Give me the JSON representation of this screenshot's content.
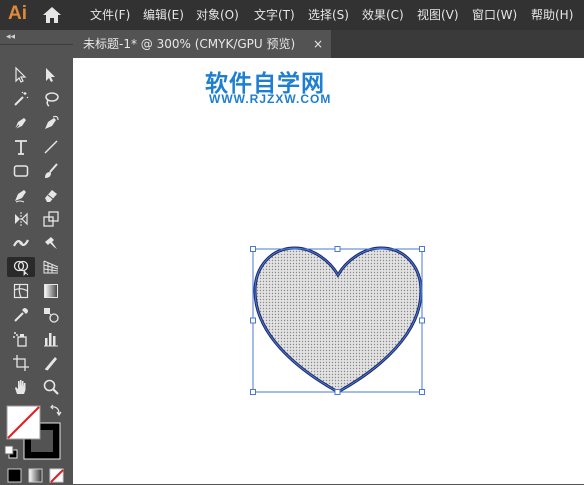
{
  "app": {
    "logo": "Ai"
  },
  "menu": {
    "items": [
      "文件(F)",
      "编辑(E)",
      "对象(O)",
      "文字(T)",
      "选择(S)",
      "效果(C)",
      "视图(V)",
      "窗口(W)",
      "帮助(H)"
    ]
  },
  "panel": {
    "collapse_glyph": "◂◂"
  },
  "tab": {
    "title": "未标题-1* @ 300% (CMYK/GPU 预览)",
    "close": "×"
  },
  "watermark": {
    "line1": "软件自学网",
    "line2": "WWW.RJZXW.COM"
  },
  "colors": {
    "accent_logo": "#e0893a",
    "selection": "#4a78d6",
    "heart_outline": "#1c2a66",
    "heart_fill": "#d9d9d9",
    "watermark": "#1e7fd0"
  },
  "tools": [
    "selection-tool",
    "direct-selection-tool",
    "magic-wand-tool",
    "lasso-tool",
    "pen-tool",
    "curvature-tool",
    "type-tool",
    "line-segment-tool",
    "rectangle-tool",
    "paintbrush-tool",
    "shaper-tool",
    "eraser-tool",
    "rotate-tool",
    "scale-tool",
    "width-tool",
    "puppet-warp-tool",
    "shape-builder-tool",
    "perspective-grid-tool",
    "mesh-tool",
    "gradient-tool",
    "eyedropper-tool",
    "blend-tool",
    "symbol-sprayer-tool",
    "column-graph-tool",
    "artboard-tool",
    "slice-tool",
    "hand-tool",
    "zoom-tool"
  ]
}
